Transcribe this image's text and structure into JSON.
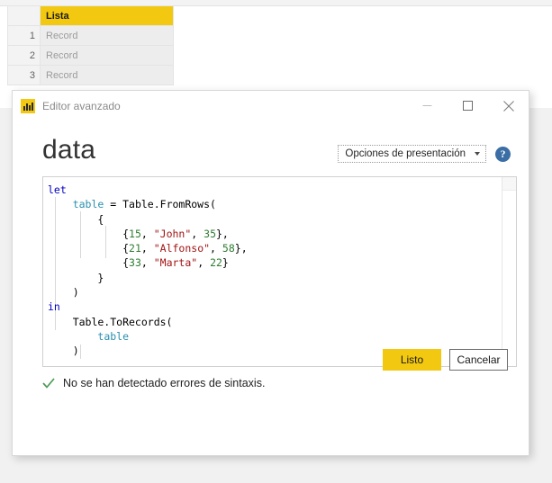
{
  "background_preview": {
    "column_header": "Lista",
    "row_header_blank": "",
    "rows": [
      {
        "index": "1",
        "value": "Record"
      },
      {
        "index": "2",
        "value": "Record"
      },
      {
        "index": "3",
        "value": "Record"
      }
    ]
  },
  "dialog": {
    "title": "Editor avanzado",
    "app_icon": "power-bi-icon",
    "window_controls": {
      "minimize": "minimize-icon",
      "maximize": "maximize-icon",
      "close": "close-icon"
    },
    "query_name": "data",
    "display_options": {
      "label": "Opciones de presentación",
      "caret": "chevron-down-icon"
    },
    "help": {
      "icon": "help-icon",
      "glyph": "?"
    },
    "editor": {
      "lines": [
        [
          {
            "t": "let",
            "c": "kw"
          }
        ],
        [
          {
            "t": "    ",
            "c": "pl"
          },
          {
            "t": "table",
            "c": "id"
          },
          {
            "t": " = Table.FromRows(",
            "c": "pl"
          }
        ],
        [
          {
            "t": "        {",
            "c": "pl"
          }
        ],
        [
          {
            "t": "            {",
            "c": "pl"
          },
          {
            "t": "15",
            "c": "num"
          },
          {
            "t": ", ",
            "c": "pl"
          },
          {
            "t": "\"John\"",
            "c": "str"
          },
          {
            "t": ", ",
            "c": "pl"
          },
          {
            "t": "35",
            "c": "num"
          },
          {
            "t": "},",
            "c": "pl"
          }
        ],
        [
          {
            "t": "            {",
            "c": "pl"
          },
          {
            "t": "21",
            "c": "num"
          },
          {
            "t": ", ",
            "c": "pl"
          },
          {
            "t": "\"Alfonso\"",
            "c": "str"
          },
          {
            "t": ", ",
            "c": "pl"
          },
          {
            "t": "58",
            "c": "num"
          },
          {
            "t": "},",
            "c": "pl"
          }
        ],
        [
          {
            "t": "            {",
            "c": "pl"
          },
          {
            "t": "33",
            "c": "num"
          },
          {
            "t": ", ",
            "c": "pl"
          },
          {
            "t": "\"Marta\"",
            "c": "str"
          },
          {
            "t": ", ",
            "c": "pl"
          },
          {
            "t": "22",
            "c": "num"
          },
          {
            "t": "}",
            "c": "pl"
          }
        ],
        [
          {
            "t": "        }",
            "c": "pl"
          }
        ],
        [
          {
            "t": "    )",
            "c": "pl"
          }
        ],
        [
          {
            "t": "in",
            "c": "kw"
          }
        ],
        [
          {
            "t": "    Table.ToRecords(",
            "c": "pl"
          }
        ],
        [
          {
            "t": "        ",
            "c": "pl"
          },
          {
            "t": "table",
            "c": "id"
          }
        ],
        [
          {
            "t": "    )",
            "c": "pl"
          }
        ]
      ],
      "plain_text": "let\n    table = Table.FromRows(\n        {\n            {15, \"John\", 35},\n            {21, \"Alfonso\", 58},\n            {33, \"Marta\", 22}\n        }\n    )\nin\n    Table.ToRecords(\n        table\n    )"
    },
    "status": {
      "icon": "check-icon",
      "text": "No se han detectado errores de sintaxis."
    },
    "buttons": {
      "ok": "Listo",
      "cancel": "Cancelar"
    }
  },
  "colors": {
    "accent_yellow": "#f2c811",
    "help_blue": "#3b6ea5",
    "status_green": "#4a9c54",
    "code_keyword": "#0000c0",
    "code_identifier": "#2b91af",
    "code_number": "#2f7d32",
    "code_string": "#a31515"
  }
}
